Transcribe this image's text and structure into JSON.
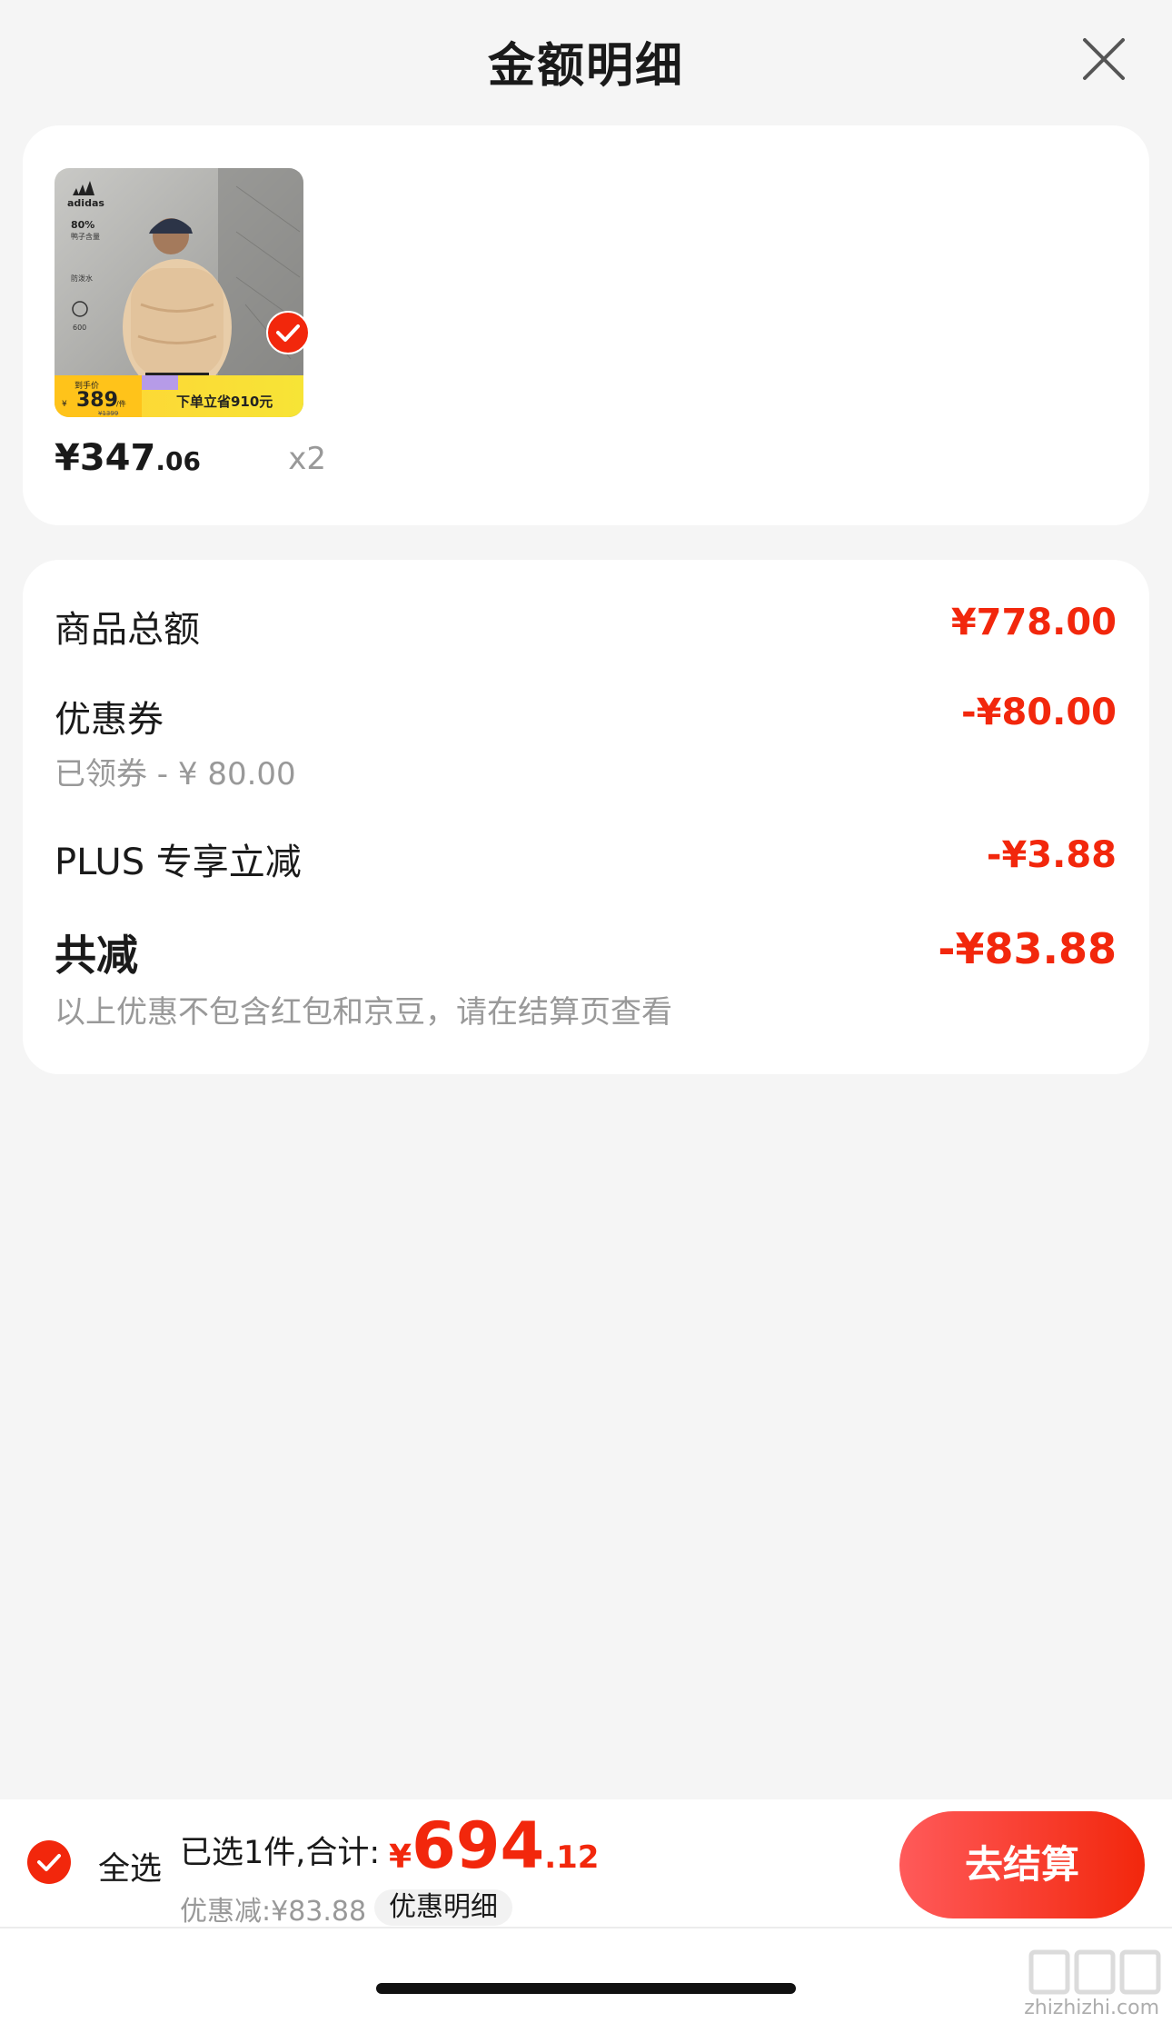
{
  "header": {
    "title": "金额明细"
  },
  "product": {
    "price_int": "¥347",
    "price_dec": ".06",
    "quantity": "x2",
    "thumbnail": {
      "badge_text": "下单立省910元",
      "price_tag": "389",
      "original_price": "¥1399",
      "label_top": "到手价",
      "feature1": "80%",
      "feature2": "鸭子含量",
      "feature3": "防泼水",
      "feature4": "600"
    },
    "selected": true
  },
  "amount_detail": {
    "rows": [
      {
        "label": "商品总额",
        "value": "¥778.00"
      },
      {
        "label": "优惠券",
        "sub": "已领券 - ¥ 80.00",
        "value": "-¥80.00"
      },
      {
        "label": "PLUS 专享立减",
        "value": "-¥3.88"
      },
      {
        "label": "共减",
        "sub": "以上优惠不包含红包和京豆，请在结算页查看",
        "value": "-¥83.88"
      }
    ]
  },
  "bottom_bar": {
    "select_all_label": "全选",
    "selected_summary": "已选1件,合计:",
    "total_symbol": "¥",
    "total_int": "694",
    "total_dec": ".12",
    "discount_line": "优惠减:¥83.88",
    "detail_chip": "优惠明细",
    "checkout_label": "去结算"
  },
  "watermark": "zhizhizhi.com",
  "colors": {
    "accent": "#f2270c",
    "background": "#f5f5f5",
    "card": "#ffffff",
    "muted": "#999999"
  }
}
